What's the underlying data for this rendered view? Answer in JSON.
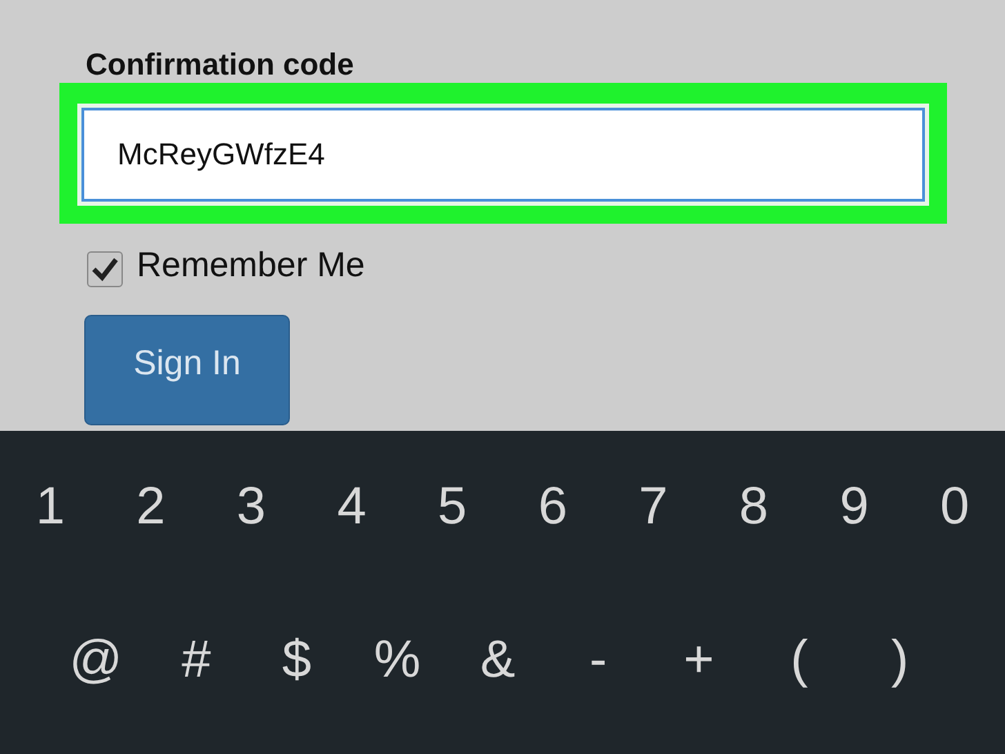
{
  "form": {
    "label": "Confirmation code",
    "value": "McReyGWfzE4",
    "highlighted": true,
    "remember": {
      "label": "Remember Me",
      "checked": true
    },
    "submit": "Sign In"
  },
  "keyboard": {
    "rows": [
      [
        "1",
        "2",
        "3",
        "4",
        "5",
        "6",
        "7",
        "8",
        "9",
        "0"
      ],
      [
        "@",
        "#",
        "$",
        "%",
        "&",
        "-",
        "+",
        "(",
        ")"
      ]
    ]
  }
}
